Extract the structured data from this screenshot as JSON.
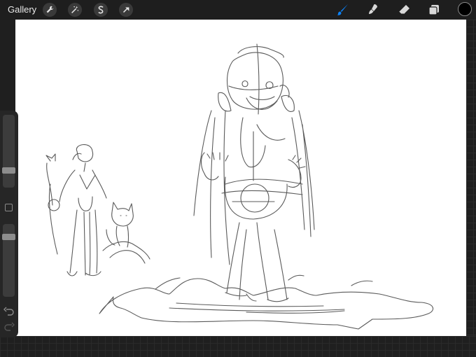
{
  "topbar": {
    "gallery_label": "Gallery",
    "left_tools": [
      "wrench-icon",
      "magic-wand-icon",
      "selection-s-icon",
      "transform-arrow-icon"
    ],
    "right_tools": [
      "brush-icon",
      "smudge-icon",
      "eraser-icon",
      "layers-icon"
    ],
    "active_tool": "brush-icon",
    "active_color": "#0a84ff",
    "current_color": "#000000"
  },
  "sidebar": {
    "brush_size_level": 0.32,
    "opacity_level": 0.1,
    "buttons": [
      "modify-square-icon",
      "undo-icon",
      "redo-icon"
    ]
  },
  "canvas": {
    "background": "#ffffff",
    "content": "pencil-sketch"
  }
}
